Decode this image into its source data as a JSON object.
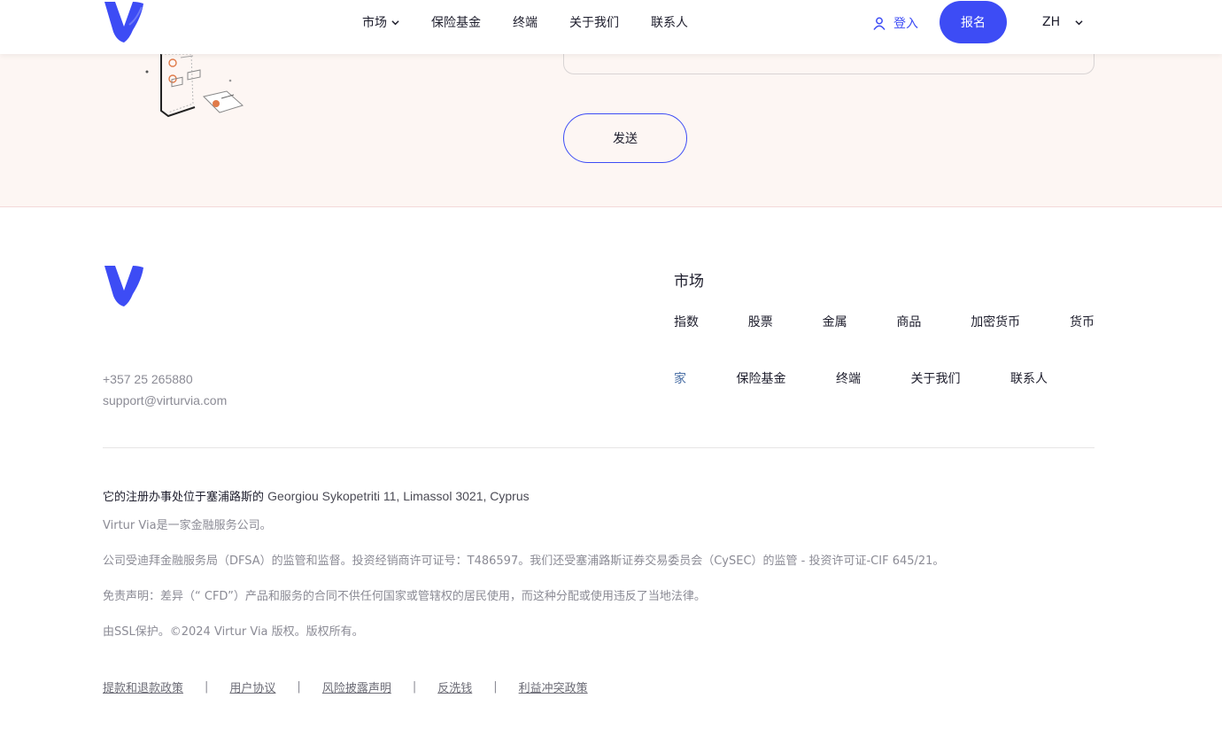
{
  "header": {
    "nav": [
      {
        "label": "市场",
        "has_dropdown": true
      },
      {
        "label": "保险基金",
        "has_dropdown": false
      },
      {
        "label": "终端",
        "has_dropdown": false
      },
      {
        "label": "关于我们",
        "has_dropdown": false
      },
      {
        "label": "联系人",
        "has_dropdown": false
      }
    ],
    "login_label": "登入",
    "signup_label": "报名",
    "language": "ZH"
  },
  "contact_form": {
    "send_label": "发送"
  },
  "footer": {
    "phone": "+357 25 265880",
    "email": "support@virturvia.com",
    "markets_heading": "市场",
    "markets_links": [
      "指数",
      "股票",
      "金属",
      "商品",
      "加密货币",
      "货币"
    ],
    "site_links": [
      "家",
      "保险基金",
      "终端",
      "关于我们",
      "联系人"
    ],
    "active_site_link": "家",
    "registered_office_prefix": "它的注册办事处位于塞浦路斯的",
    "registered_office_address": "Georgiou Sykopetriti 11, Limassol 3021, Cyprus",
    "company_line": "Virtur Via是一家金融服务公司。",
    "regulation_line": "公司受迪拜金融服务局（DFSA）的监管和监督。投资经销商许可证号：T486597。我们还受塞浦路斯证券交易委员会（CySEC）的监管 - 投资许可证-CIF 645/21。",
    "disclaimer_line": "免责声明：差异（“ CFD”）产品和服务的合同不供任何国家或管辖权的居民使用，而这种分配或使用违反了当地法律。",
    "copyright_line": "由SSL保护。©2024 Virtur Via 版权。版权所有。",
    "policies": [
      "提款和退款政策",
      "用户协议",
      "风险披露声明",
      "反洗钱",
      "利益冲突政策"
    ],
    "policy_separator": "|"
  },
  "colors": {
    "accent": "#3d4cf5",
    "band_bg": "#fdf6f3",
    "muted_text": "#8b8b95"
  }
}
